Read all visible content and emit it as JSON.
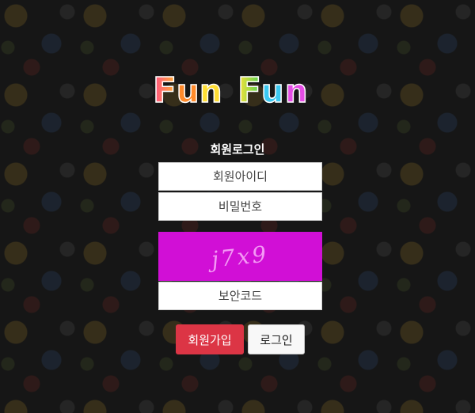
{
  "logo": {
    "text": "FunFun"
  },
  "form": {
    "title": "회원로그인",
    "id_placeholder": "회원아이디",
    "password_placeholder": "비밀번호",
    "captcha_text": "j7x9",
    "captcha_color": "#d10fd6",
    "security_code_placeholder": "보안코드"
  },
  "buttons": {
    "signup_label": "회원가입",
    "signup_color": "#dc3545",
    "login_label": "로그인"
  }
}
